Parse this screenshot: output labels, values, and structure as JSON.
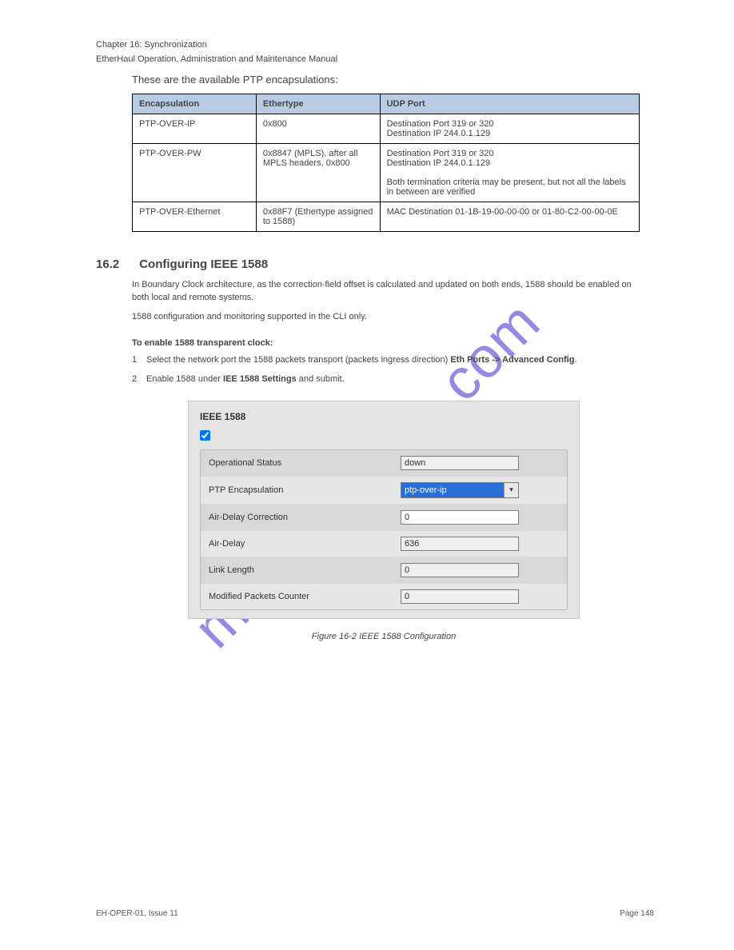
{
  "header": {
    "chapter": "Chapter 16:  Synchronization",
    "doc": "EtherHaul Operation, Administration and Maintenance Manual"
  },
  "intro": "These are the available PTP encapsulations:",
  "spec_table": {
    "headers": [
      "Encapsulation",
      "Ethertype",
      "UDP Port"
    ],
    "rows": [
      [
        "PTP-OVER-IP",
        "0x800",
        "Destination Port 319 or 320\nDestination IP 244.0.1.129"
      ],
      [
        "PTP-OVER-PW",
        "0x8847 (MPLS), after all MPLS headers, 0x800",
        "Destination Port 319 or 320\nDestination IP 244.0.1.129\n\nBoth termination criteria may be present, but not all the labels in between are verified"
      ],
      [
        "PTP-OVER-Ethernet",
        "0x88F7 (Ethertype assigned to 1588)",
        "MAC Destination 01-1B-19-00-00-00 or 01-80-C2-00-00-0E"
      ]
    ]
  },
  "section": {
    "number": "16.2",
    "title": "Configuring IEEE 1588"
  },
  "body_p1": "In Boundary Clock architecture, as the correction-field offset is calculated and updated on both ends, 1588 should be enabled on both local and remote systems.",
  "body_p2": "1588 configuration and monitoring supported in the CLI only.",
  "steps_title": "To enable 1588 transparent clock:",
  "steps": [
    {
      "n": "1",
      "text_prefix": "Select the network port the 1588 packets transport (packets ingress direction) ",
      "nav": "Eth Ports -> Advanced Config",
      "text_suffix": "."
    },
    {
      "n": "2",
      "text_prefix": "Enable 1588 under ",
      "nav": "IEE 1588 Settings",
      "text_suffix": " and submit."
    }
  ],
  "ui": {
    "title": "IEEE 1588",
    "checked": true,
    "rows": [
      {
        "label": "Operational Status",
        "value": "down",
        "type": "readonly"
      },
      {
        "label": "PTP Encapsulation",
        "value": "ptp-over-ip",
        "type": "select"
      },
      {
        "label": "Air-Delay Correction",
        "value": "0",
        "type": "input"
      },
      {
        "label": "Air-Delay",
        "value": "636",
        "type": "readonly"
      },
      {
        "label": "Link Length",
        "value": "0",
        "type": "readonly"
      },
      {
        "label": "Modified Packets Counter",
        "value": "0",
        "type": "readonly"
      }
    ]
  },
  "figure": "Figure 16-2 IEEE 1588 Configuration",
  "footer": {
    "left": "EH-OPER-01, Issue 11",
    "right": "Page 148"
  },
  "watermark": "manualshive.com"
}
